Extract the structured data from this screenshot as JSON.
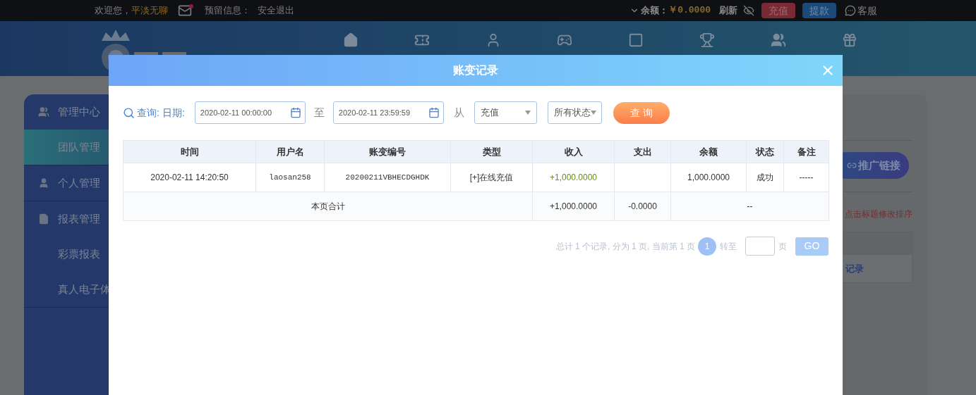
{
  "top_bar": {
    "welcome": "欢迎您，",
    "username": "平淡无聊",
    "reserved_info": "预留信息：",
    "logout": "安全退出",
    "balance_label": "余额：",
    "balance": "￥0.0000",
    "refresh": "刷新",
    "buttons": [
      {
        "label": "充值",
        "kind": "deposit"
      },
      {
        "label": "提款",
        "kind": "withdraw"
      }
    ],
    "support": "客服"
  },
  "sidebar": {
    "items": [
      {
        "label": "管理中心",
        "kind": "team",
        "selected": false,
        "children": [
          {
            "label": "团队管理",
            "selected": true
          }
        ]
      },
      {
        "label": "个人管理",
        "kind": "user",
        "selected": false
      },
      {
        "label": "报表管理",
        "kind": "report",
        "selected": false,
        "children": [
          {
            "label": "彩票报表",
            "selected": false
          },
          {
            "label": "真人电子体",
            "selected": false
          }
        ]
      }
    ]
  },
  "side_panel": {
    "button": "推广链接",
    "hint": "点击标题修改排序",
    "link": "记录"
  },
  "modal": {
    "title": "账变记录",
    "filter": {
      "label": "查询:",
      "date_label": "日期:",
      "start": "2020-02-11 00:00:00",
      "to": "至",
      "end": "2020-02-11 23:59:59",
      "from": "从",
      "type_select": "充值",
      "status_select": "所有状态",
      "search_button": "查 询"
    },
    "table": {
      "columns": [
        "时间",
        "用户名",
        "账变编号",
        "类型",
        "收入",
        "支出",
        "余额",
        "状态",
        "备注"
      ],
      "rows": [
        {
          "time": "2020-02-11 14:20:50",
          "user": "laosan258",
          "serial": "20200211VBHECDGHDK",
          "type": "[+]在线充值",
          "income": "+1,000.0000",
          "balance": "1,000.0000",
          "status": "成功",
          "note": "-----"
        }
      ],
      "summary": {
        "label": "本页合计",
        "income": "+1,000.0000",
        "expense": "-0.0000",
        "rest": "--"
      }
    },
    "pagination": {
      "summary": "总计 1 个记录, 分为 1 页, 当前第 1 页",
      "pages": [
        {
          "label": "1",
          "selected": true
        }
      ],
      "goto": "转至",
      "page_unit": "页",
      "go": "GO"
    }
  }
}
